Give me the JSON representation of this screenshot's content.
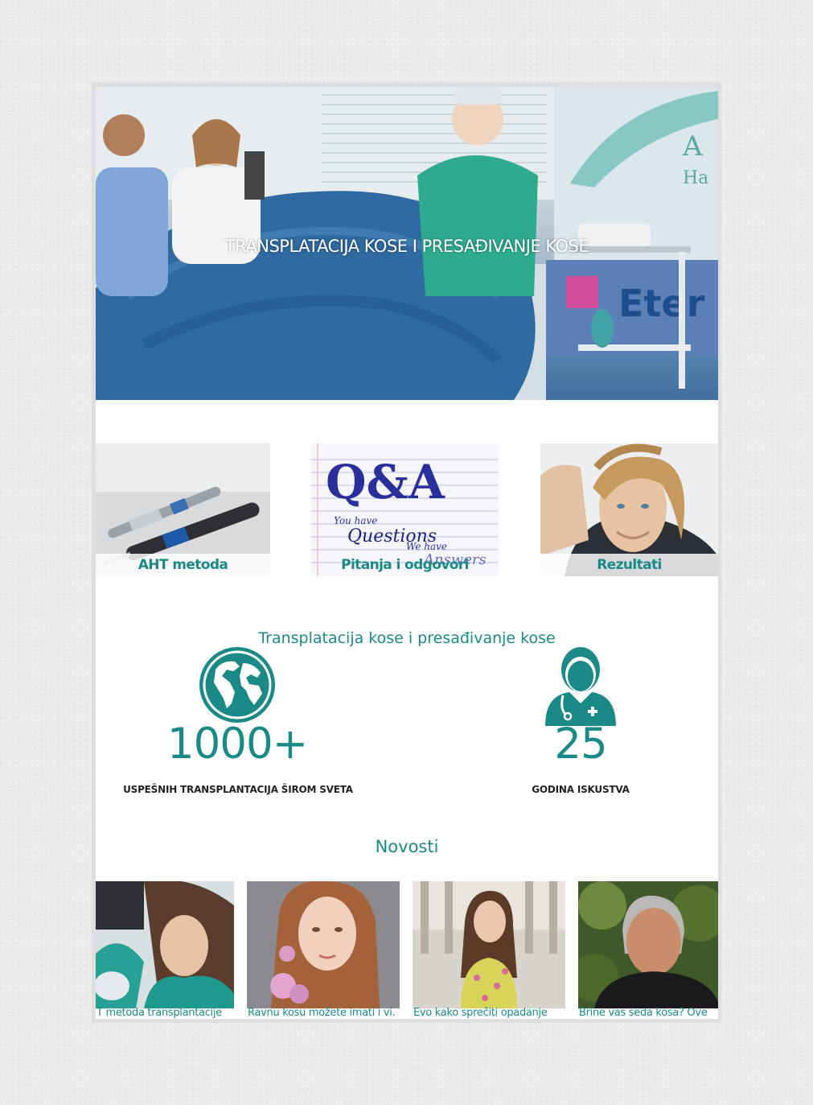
{
  "hero": {
    "title": "TRANSPLATACIJA KOSE I PRESAĐIVANJE KOSE",
    "image": "hair-transplant-surgery-photo"
  },
  "features": [
    {
      "label": "AHT metoda",
      "image": "surgical-handpiece-photo"
    },
    {
      "label": "Pitanja i odgovori",
      "image": "qa-notebook-image"
    },
    {
      "label": "Rezultati",
      "image": "man-with-long-hair-photo"
    }
  ],
  "stats": {
    "heading": "Transplatacija kose i presađivanje kose",
    "items": [
      {
        "number": "1000+",
        "caption": "USPEŠNIH TRANSPLANTACIJA ŠIROM SVETA",
        "icon": "globe-icon"
      },
      {
        "number": "25",
        "caption": "GODINA ISKUSTVA",
        "icon": "doctor-icon"
      }
    ]
  },
  "news": {
    "heading": "Novosti",
    "items": [
      {
        "title": "T metoda transplantacije",
        "image": "clinic-patient-photo"
      },
      {
        "title": "Ravnu kosu možete imati i vi.",
        "image": "woman-straight-hair-photo"
      },
      {
        "title": "Evo kako sprečiti opadanje",
        "image": "woman-touching-hair-photo"
      },
      {
        "title": "Brine vas seda kosa? Ove",
        "image": "grey-haired-man-photo"
      }
    ]
  },
  "colors": {
    "accent": "#1b8a86",
    "background": "#ecebea",
    "frame": "#dedede",
    "caption": "#222222"
  }
}
